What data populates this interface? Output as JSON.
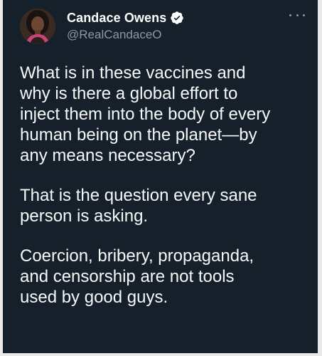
{
  "tweet": {
    "author": {
      "display_name": "Candace Owens",
      "handle": "@RealCandaceO",
      "verified": true,
      "avatar_icon": "profile-photo"
    },
    "more_icon": "ellipsis-icon",
    "paragraphs": [
      "What is in these vaccines and\nwhy is there a global effort to\ninject them into the body of every\nhuman being on the planet—by\nany means necessary?",
      "That is the question every sane\nperson is asking.",
      "Coercion, bribery, propaganda,\nand censorship are not tools\nused by good guys."
    ]
  },
  "colors": {
    "background": "#15202b",
    "text": "#f7f9f9",
    "secondary_text": "#8b98a5",
    "verified_badge": "#ffffff"
  }
}
